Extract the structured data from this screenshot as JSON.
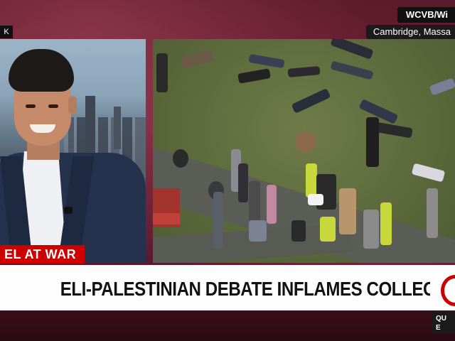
{
  "broadcast": {
    "station_tag": "WCVB/Wi",
    "location": "Cambridge, Massa",
    "left_tag": "K",
    "topic_label": "EL AT WAR",
    "headline": "ELI-PALESTINIAN DEBATE INFLAMES COLLEGE CAMPUSES",
    "corner_tag_line1": "QU",
    "corner_tag_line2": "E"
  },
  "colors": {
    "accent_red": "#cc0000",
    "background": "#6a1f33",
    "chyron_bg": "#fdfdfd"
  },
  "icons": {
    "logo": "cnn-logo-icon"
  }
}
